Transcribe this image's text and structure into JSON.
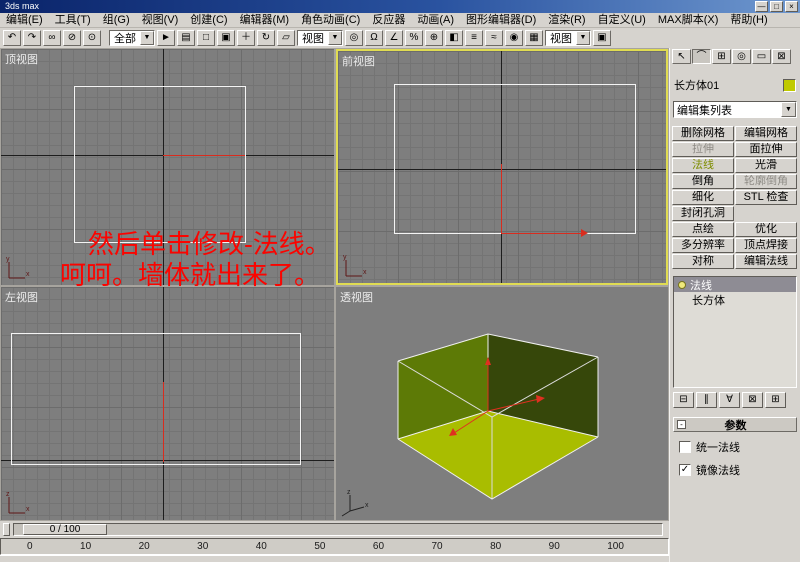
{
  "window": {
    "title": "3ds max",
    "controls": [
      {
        "glyph": "—"
      },
      {
        "glyph": "□"
      },
      {
        "glyph": "×"
      }
    ]
  },
  "menu": {
    "items": [
      "编辑(E)",
      "工具(T)",
      "组(G)",
      "视图(V)",
      "创建(C)",
      "编辑器(M)",
      "角色动画(C)",
      "反应器",
      "动画(A)",
      "图形编辑器(D)",
      "渲染(R)",
      "自定义(U)",
      "MAX脚本(X)",
      "帮助(H)"
    ]
  },
  "toolbar": {
    "icons_a": [
      {
        "glyph": "↶"
      },
      {
        "glyph": "↷"
      },
      {
        "glyph": "∞"
      },
      {
        "glyph": "⊘"
      },
      {
        "glyph": "⊙"
      }
    ],
    "filter_combo": {
      "value": "全部"
    },
    "icons_b": [
      {
        "glyph": "►"
      },
      {
        "glyph": "▤"
      },
      {
        "glyph": "□"
      },
      {
        "glyph": "▣"
      },
      {
        "glyph": "＋"
      },
      {
        "glyph": "↻"
      },
      {
        "glyph": "▱"
      }
    ],
    "coord_combo": {
      "value": "视图"
    },
    "icons_c": [
      {
        "glyph": "◎"
      },
      {
        "glyph": "Ω"
      },
      {
        "glyph": "∠"
      },
      {
        "glyph": "%"
      },
      {
        "glyph": "⊕"
      },
      {
        "glyph": "◧"
      },
      {
        "glyph": "≡"
      },
      {
        "glyph": "≈"
      },
      {
        "glyph": "◉"
      },
      {
        "glyph": "▦"
      }
    ],
    "render_combo": {
      "value": "视图"
    },
    "icons_d": [
      {
        "glyph": "▣"
      }
    ]
  },
  "icons": {
    "dropdown_arrow": "▼",
    "check": "✓",
    "collapse": "-",
    "axis_x": "x",
    "axis_y": "y",
    "axis_z": "z"
  },
  "viewports": {
    "top_label": "顶视图",
    "front_label": "前视图",
    "left_label": "左视图",
    "persp_label": "透视图"
  },
  "overlay": {
    "line1": "然后单击修改-法线。",
    "line2": "呵呵。墙体就出来了。",
    "color": "#ff0000"
  },
  "command_panel": {
    "tabs": [
      {
        "glyph": "↖"
      },
      {
        "glyph": "⌒"
      },
      {
        "glyph": "⊞"
      },
      {
        "glyph": "◎"
      },
      {
        "glyph": "▭"
      },
      {
        "glyph": "⊠"
      }
    ],
    "object_name": "长方体01",
    "object_color": "#c0ca00",
    "modifier_list_label": "编辑集列表",
    "buttons": [
      {
        "label": "删除网格",
        "state": ""
      },
      {
        "label": "编辑网格",
        "state": ""
      },
      {
        "label": "拉伸",
        "state": "disabled"
      },
      {
        "label": "面拉伸",
        "state": ""
      },
      {
        "label": "法线",
        "state": "active"
      },
      {
        "label": "光滑",
        "state": ""
      },
      {
        "label": "倒角",
        "state": ""
      },
      {
        "label": "轮廓倒角",
        "state": "disabled"
      },
      {
        "label": "细化",
        "state": ""
      },
      {
        "label": "STL 检查",
        "state": ""
      },
      {
        "label": "封闭孔洞",
        "state": ""
      },
      {
        "label": "",
        "state": "empty"
      },
      {
        "label": "点绘",
        "state": ""
      },
      {
        "label": "优化",
        "state": ""
      },
      {
        "label": "多分辨率",
        "state": ""
      },
      {
        "label": "顶点焊接",
        "state": ""
      },
      {
        "label": "对称",
        "state": ""
      },
      {
        "label": "编辑法线",
        "state": ""
      }
    ],
    "stack": {
      "items": [
        {
          "label": "法线",
          "selected": true
        },
        {
          "label": "长方体",
          "selected": false
        }
      ]
    },
    "stack_tools": [
      {
        "glyph": "⊟"
      },
      {
        "glyph": "∥"
      },
      {
        "glyph": "∀"
      },
      {
        "glyph": "⊠"
      },
      {
        "glyph": "⊞"
      }
    ],
    "parameters": {
      "title": "参数",
      "checkboxes": [
        {
          "label": "统一法线",
          "checked": false
        },
        {
          "label": "镜像法线",
          "checked": true
        }
      ]
    }
  },
  "timeline": {
    "slider_value": "0 / 100",
    "ticks": [
      "0",
      "10",
      "20",
      "30",
      "40",
      "50",
      "60",
      "70",
      "80",
      "90",
      "100"
    ]
  }
}
